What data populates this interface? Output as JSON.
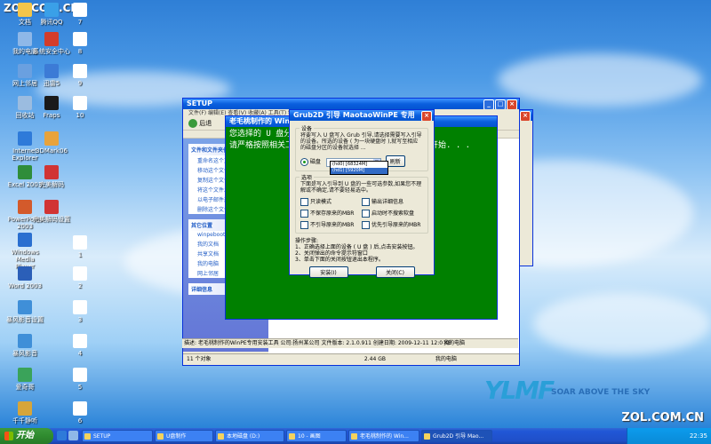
{
  "watermark": {
    "top": "ZOL.COM.CN",
    "bottom": "ZOL.COM.CN"
  },
  "desktop_icons": [
    {
      "label": "文档",
      "color": "#f3c54a"
    },
    {
      "label": "腾讯QQ",
      "color": "#3aa0e8"
    },
    {
      "label": "7",
      "color": "#ffffff"
    },
    {
      "label": "我的电脑",
      "color": "#8fb8e8"
    },
    {
      "label": "系统安全中心",
      "color": "#d33c2b"
    },
    {
      "label": "8",
      "color": "#ffffff"
    },
    {
      "label": "网上邻居",
      "color": "#6aa0e0"
    },
    {
      "label": "迅雷5",
      "color": "#3c7bd6"
    },
    {
      "label": "9",
      "color": "#ffffff"
    },
    {
      "label": "回收站",
      "color": "#9bbce0"
    },
    {
      "label": "Fraps",
      "color": "#1a1a1a"
    },
    {
      "label": "10",
      "color": "#ffffff"
    },
    {
      "label": "Internet Explorer",
      "color": "#2e7ad9"
    },
    {
      "label": "3DMark06",
      "color": "#e8a33c"
    },
    {
      "label": "Excel 2003",
      "color": "#2f8d3a"
    },
    {
      "label": "完美解码",
      "color": "#d13434"
    },
    {
      "label": "PowerPoint 2003",
      "color": "#d35a2b"
    },
    {
      "label": "完美解码设置",
      "color": "#d13434"
    },
    {
      "label": "Windows Media Player",
      "color": "#2a6fd0"
    },
    {
      "label": "1",
      "color": "#ffffff"
    },
    {
      "label": "Word 2003",
      "color": "#2b5fb8"
    },
    {
      "label": "2",
      "color": "#ffffff"
    },
    {
      "label": "暴风影音设置",
      "color": "#3f8fd8"
    },
    {
      "label": "3",
      "color": "#ffffff"
    },
    {
      "label": "暴风影音",
      "color": "#3f8fd8"
    },
    {
      "label": "4",
      "color": "#ffffff"
    },
    {
      "label": "爱奇哥",
      "color": "#3aa35a"
    },
    {
      "label": "5",
      "color": "#ffffff"
    },
    {
      "label": "千千静听",
      "color": "#d6a53a"
    },
    {
      "label": "6",
      "color": "#ffffff"
    }
  ],
  "explorer": {
    "title": "SETUP",
    "menu": "文件(F)  编辑(E)  查看(V)  收藏(A)  工具(T)  帮助(H)",
    "back_label": "后退",
    "file_tasks": {
      "header": "文件和文件夹任务",
      "items": [
        "重命名这个文件",
        "移动这个文件",
        "复制这个文件",
        "将这个文件发布到 Web",
        "以电子邮件形式发送此文件",
        "删除这个文件"
      ]
    },
    "other_places": {
      "header": "其它位置",
      "items": [
        "winpebootcd",
        "我的文档",
        "共享文档",
        "我的电脑",
        "网上邻居"
      ]
    },
    "details_header": "详细信息",
    "status_left": "11 个对象",
    "status_size": "2.44 GB",
    "status_right": "我的电脑"
  },
  "desc_strip": {
    "text": "描述: 老毛桃制作的WinPE专用安装工具 公司:扬州某公司 文件版本: 2.1.0.911 创建日期: 2009-12-11 12:0 KB",
    "right": "我的电脑"
  },
  "console": {
    "title": "老毛桃制作的 Win",
    "line1": "您选择的 U 盘分区文",
    "line2": "请严格按照相关工具",
    "line2_tail": "开始. . ."
  },
  "grub": {
    "title": "Grub2D 引导 MaotaoWinPE 专用",
    "device_group": "设备",
    "device_desc": "将要写入 U 盘写入 Grub 引导,请选择需要写入引导的设备。所选的设备 ( 为一块硬盘时 ),就写至相应的磁盘分区的设备就选择 ...",
    "disk_label": "磁盘",
    "refresh": "刷新",
    "dropdown_items": [
      "(hd0) [68324M]",
      "(hd1) [5920M]"
    ],
    "options_group": "选项",
    "options_desc": "下面是写入引导到 U 盘的一些可选参数,如果您不理解或不确定,请不要轻易选中。",
    "options": [
      "只读模式",
      "输出详细信息",
      "不保存原来的MBR",
      "启动时不搜索软盘",
      "不引导原来的MBR",
      "优先引导原来的MBR"
    ],
    "steps_title": "操作步骤:",
    "steps": [
      "1、正确选择上面的设备 ( U 盘 ) 后,点击安装按钮。",
      "2、关闭弹出的命令提示符窗口",
      "3、单击下面的关闭按钮退出本程序。"
    ],
    "install": "安装(I)",
    "close": "关闭(C)"
  },
  "logo": {
    "mark": "YLMF",
    "tagline": "SOAR ABOVE THE SKY"
  },
  "taskbar": {
    "start": "开始",
    "items": [
      "SETUP",
      "U盘制作",
      "本地磁盘 (D:)",
      "10 - 画图",
      "老毛桃制作的 Win...",
      "Grub2D 引导 Mao..."
    ],
    "clock": "22:35"
  }
}
